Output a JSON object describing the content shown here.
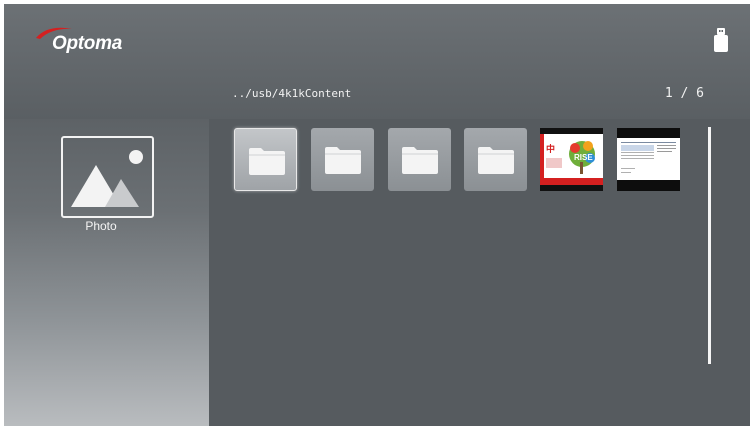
{
  "header": {
    "brand": "Optoma",
    "device_icon": "usb-drive-icon"
  },
  "browser": {
    "path": "../usb/4k1kContent",
    "page_indicator": "1 / 6"
  },
  "category": {
    "label": "Photo",
    "icon": "photo-icon"
  },
  "items": [
    {
      "type": "folder",
      "icon": "folder-icon",
      "selected": true
    },
    {
      "type": "folder",
      "icon": "folder-icon",
      "selected": false
    },
    {
      "type": "folder",
      "icon": "folder-icon",
      "selected": false
    },
    {
      "type": "folder",
      "icon": "folder-icon",
      "selected": false
    },
    {
      "type": "image",
      "selected": false
    },
    {
      "type": "image",
      "selected": false
    }
  ],
  "image_thumbnail_1": {
    "text_large": "RISE",
    "text_cn": "中"
  },
  "colors": {
    "accent_red": "#d42020",
    "background": "#565b5f"
  }
}
